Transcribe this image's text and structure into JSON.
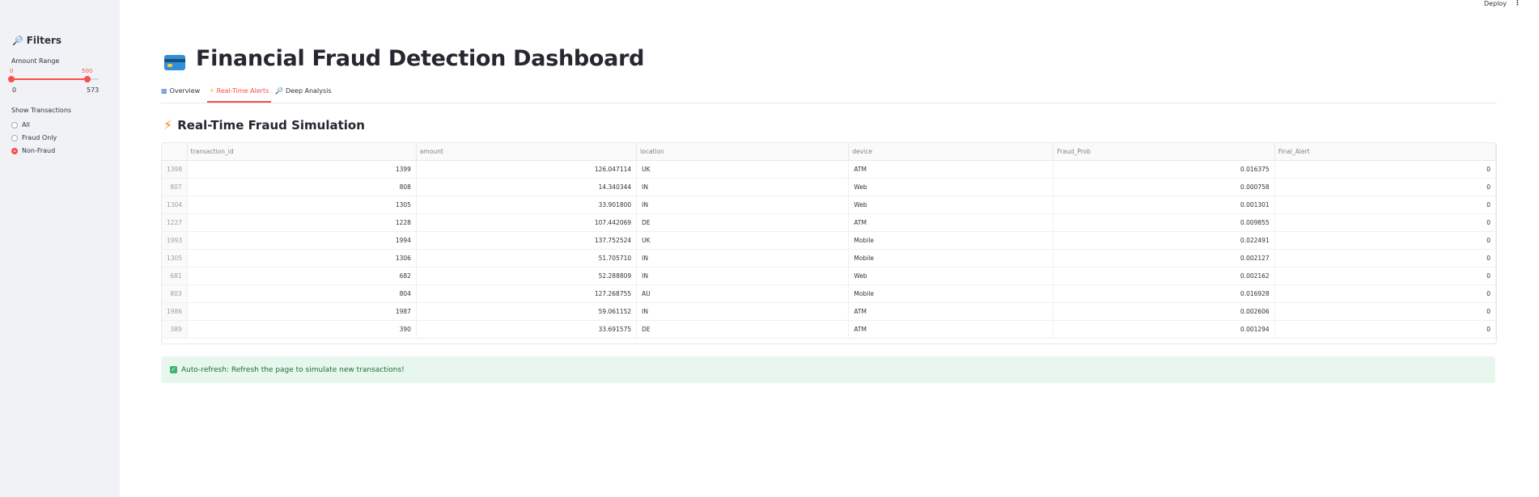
{
  "header": {
    "deploy_label": "Deploy",
    "menu_icon": "kebab-menu-icon"
  },
  "sidebar": {
    "title": "Filters",
    "title_icon": "magnifier-icon",
    "amount_range": {
      "label": "Amount Range",
      "low": "0",
      "high": "500",
      "min": "0",
      "max": "573",
      "low_fraction": 0,
      "high_fraction": 0.873
    },
    "show_transactions": {
      "label": "Show Transactions",
      "options": [
        "All",
        "Fraud Only",
        "Non-Fraud"
      ],
      "selected": "Non-Fraud"
    }
  },
  "main": {
    "title": "Financial Fraud Detection Dashboard",
    "title_icon": "credit-card-icon",
    "tabs": [
      {
        "label": "Overview",
        "icon": "bar-chart-icon"
      },
      {
        "label": "Real-Time Alerts",
        "icon": "lightning-icon"
      },
      {
        "label": "Deep Analysis",
        "icon": "magnifier-icon"
      }
    ],
    "active_tab": "Real-Time Alerts",
    "section_title": "Real-Time Fraud Simulation",
    "table": {
      "columns": [
        "transaction_id",
        "amount",
        "location",
        "device",
        "Fraud_Prob",
        "Final_Alert"
      ],
      "rows": [
        [
          "1398",
          "1399",
          "126.047114",
          "UK",
          "ATM",
          "0.016375",
          "0"
        ],
        [
          "807",
          "808",
          "14.340344",
          "IN",
          "Web",
          "0.000758",
          "0"
        ],
        [
          "1304",
          "1305",
          "33.901800",
          "IN",
          "Web",
          "0.001301",
          "0"
        ],
        [
          "1227",
          "1228",
          "107.442069",
          "DE",
          "ATM",
          "0.009855",
          "0"
        ],
        [
          "1993",
          "1994",
          "137.752524",
          "UK",
          "Mobile",
          "0.022491",
          "0"
        ],
        [
          "1305",
          "1306",
          "51.705710",
          "IN",
          "Mobile",
          "0.002127",
          "0"
        ],
        [
          "681",
          "682",
          "52.288809",
          "IN",
          "Web",
          "0.002162",
          "0"
        ],
        [
          "803",
          "804",
          "127.268755",
          "AU",
          "Mobile",
          "0.016928",
          "0"
        ],
        [
          "1986",
          "1987",
          "59.061152",
          "IN",
          "ATM",
          "0.002606",
          "0"
        ],
        [
          "389",
          "390",
          "33.691575",
          "DE",
          "ATM",
          "0.001294",
          "0"
        ]
      ]
    },
    "info_message": "Auto-refresh: Refresh the page to simulate new transactions!"
  }
}
